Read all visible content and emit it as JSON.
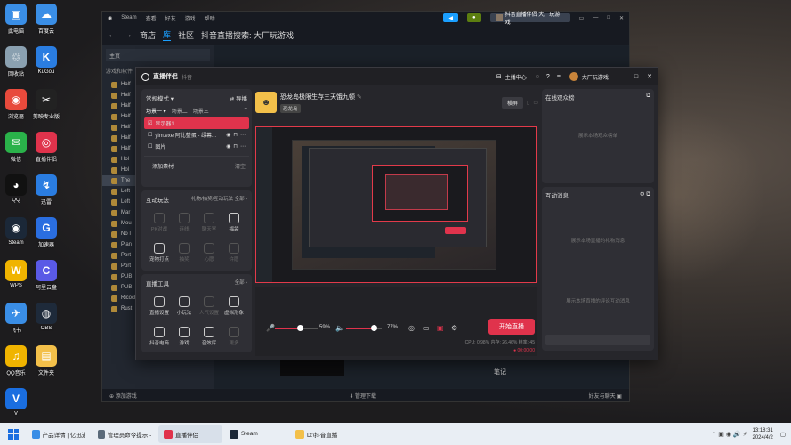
{
  "desktop": {
    "icons": [
      {
        "label": "此电脑",
        "color": "#3a8ee6"
      },
      {
        "label": "百度云",
        "color": "#3a8ee6"
      },
      {
        "label": "回收站",
        "color": "#8aa0b0"
      },
      {
        "label": "KuGou",
        "color": "#2a7de1"
      },
      {
        "label": "浏览器",
        "color": "#e84a3c"
      },
      {
        "label": "剪映专业版",
        "color": "#222222"
      },
      {
        "label": "微信",
        "color": "#2ab24a"
      },
      {
        "label": "直播伴侣",
        "color": "#e0334c"
      },
      {
        "label": "QQ",
        "color": "#111111"
      },
      {
        "label": "迅雷",
        "color": "#2a7de1"
      },
      {
        "label": "Steam",
        "color": "#1b2838"
      },
      {
        "label": "加速器",
        "color": "#2a6ee0"
      },
      {
        "label": "WPS",
        "color": "#f0b400"
      },
      {
        "label": "阿里云盘",
        "color": "#5a5ae6"
      },
      {
        "label": "飞书",
        "color": "#3a8ee6"
      },
      {
        "label": "OBS",
        "color": "#1e2a3a"
      },
      {
        "label": "QQ音乐",
        "color": "#f0b400"
      },
      {
        "label": "文件夹",
        "color": "#f3c04a"
      },
      {
        "label": "V",
        "color": "#1a6ee0"
      }
    ]
  },
  "steam": {
    "menu": [
      "Steam",
      "查看",
      "好友",
      "游戏",
      "帮助"
    ],
    "nav": [
      "商店",
      "库",
      "社区",
      "抖音直播搜索: 大厂玩游戏"
    ],
    "home": "主页",
    "games_header": "游戏和软件",
    "games": [
      "Half",
      "Half",
      "Half",
      "Half",
      "Half",
      "Half",
      "Half",
      "Hol",
      "Hol",
      "The",
      "Left",
      "Left",
      "Mar",
      "Mou",
      "No I",
      "Plan",
      "Port",
      "Port",
      "PUB",
      "PUB",
      "Ricochet",
      "Rust"
    ],
    "add_game": "添加游戏",
    "manage_downloads": "管理下载",
    "friends_chat": "好友与聊天",
    "user": "抖音直播伴侣 大厂玩游戏",
    "notes": "笔记"
  },
  "live": {
    "app_title": "直播伴侣",
    "app_sub": "抖音",
    "anchor_center": "主播中心",
    "username": "大厂玩游戏",
    "mode": "常规模式",
    "guide": "导播",
    "scenes": [
      "场景一",
      "场景二",
      "场景三"
    ],
    "sources": [
      {
        "name": "显示器1",
        "active": true
      },
      {
        "name": "ylm.exe 阿比整蛋 - 绿幕...",
        "active": false
      },
      {
        "name": "图片",
        "active": false
      }
    ],
    "add_source": "添加素材",
    "clear": "清空",
    "interact_title": "互动玩法",
    "interact_hint": "礼物/抽奖/互动玩法 全部 ›",
    "interact_tools": [
      {
        "label": "PK对战",
        "dim": true
      },
      {
        "label": "连线",
        "dim": true
      },
      {
        "label": "聊天室",
        "dim": true
      },
      {
        "label": "福袋",
        "dim": false
      },
      {
        "label": "宠物打点",
        "dim": false
      },
      {
        "label": "抽奖",
        "dim": true
      },
      {
        "label": "心愿",
        "dim": true
      },
      {
        "label": "许愿",
        "dim": true
      }
    ],
    "tools_title": "直播工具",
    "tools_all": "全部 ›",
    "tools": [
      {
        "label": "直播设置",
        "dim": false
      },
      {
        "label": "小玩法",
        "dim": false
      },
      {
        "label": "人气设置",
        "dim": true
      },
      {
        "label": "虚拟形象",
        "dim": false
      },
      {
        "label": "抖音电商",
        "dim": false
      },
      {
        "label": "游戏",
        "dim": false
      },
      {
        "label": "音效库",
        "dim": false
      },
      {
        "label": "更多",
        "dim": true
      }
    ],
    "room_title": "恐龙岛极限生存三天饿九顿",
    "room_tag": "恐龙岛",
    "view_toggle": "横屏",
    "mic_percent": "59%",
    "speaker_percent": "77%",
    "mic_level": 0.59,
    "speaker_level": 0.77,
    "start_button": "开始直播",
    "stats": "CPU: 0.98%  内存: 26.46%  帧率: 45",
    "live_time": "00:00:00",
    "online_title": "在线观众榜",
    "online_empty": "展示本场观众榜单",
    "messages_title": "互动消息",
    "messages_empty": "展示本场直播的礼物消息",
    "chat_empty": "展示本场直播的评论互动消息"
  },
  "taskbar": {
    "apps": [
      {
        "label": "产品详情 | 亿迅通...",
        "color": "#3a8ee6"
      },
      {
        "label": "管理员命令提示 - 记...",
        "color": "#5a6a7a"
      },
      {
        "label": "直播伴侣",
        "color": "#e0334c"
      },
      {
        "label": "Steam",
        "color": "#1b2838"
      },
      {
        "label": "D:\\抖音直播",
        "color": "#f3c04a"
      }
    ],
    "time": "13:18:31",
    "date": "2024/4/2"
  }
}
